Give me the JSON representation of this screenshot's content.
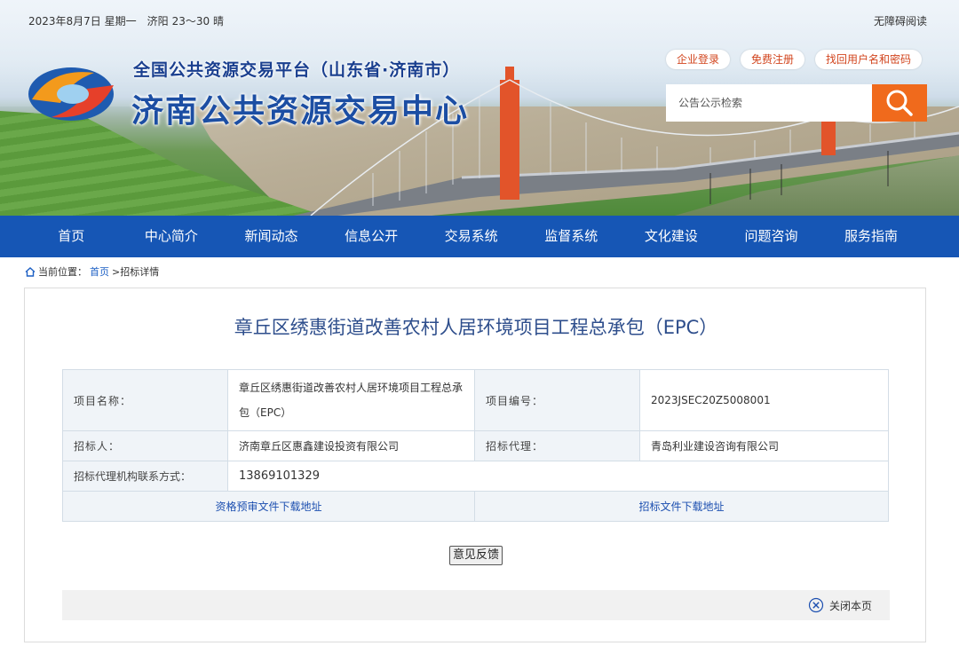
{
  "topbar": {
    "date": "2023年8月7日  星期一",
    "city": "济阳",
    "temperature": "23～30 晴",
    "accessible_label": "无障碍阅读"
  },
  "header": {
    "subtitle": "全国公共资源交易平台（山东省·济南市）",
    "title": "济南公共资源交易中心"
  },
  "user_links": {
    "login": "企业登录",
    "register": "免费注册",
    "recover": "找回用户名和密码"
  },
  "search": {
    "placeholder": "公告公示检索",
    "icon": "search-icon"
  },
  "nav": {
    "items": [
      "首页",
      "中心简介",
      "新闻动态",
      "信息公开",
      "交易系统",
      "监督系统",
      "文化建设",
      "问题咨询",
      "服务指南"
    ]
  },
  "breadcrumb": {
    "prefix": "当前位置：",
    "home": "首页",
    "current": ">招标详情"
  },
  "page": {
    "title": "章丘区绣惠街道改善农村人居环境项目工程总承包（EPC）"
  },
  "info": {
    "project_name_label": "项目名称：",
    "project_name_line1": "章丘区绣惠街道改善农村人居环境项目工程总承",
    "project_name_line2": "包（EPC）",
    "project_no_label": "项目编号：",
    "project_no": "2023JSEC20Z5008001",
    "tenderer_label": "招标人：",
    "tenderer": "济南章丘区惠鑫建设投资有限公司",
    "agent_label": "招标代理：",
    "agent": "青岛利业建设咨询有限公司",
    "contact_label": "招标代理机构联系方式：",
    "contact": "13869101329",
    "prequal_download": "资格预审文件下载地址",
    "tender_download": "招标文件下载地址"
  },
  "actions": {
    "feedback": "意见反馈",
    "close": "关闭本页"
  },
  "colors": {
    "nav": "#1656b5",
    "search_button": "#f06a1c",
    "title": "#2e4e8c"
  }
}
